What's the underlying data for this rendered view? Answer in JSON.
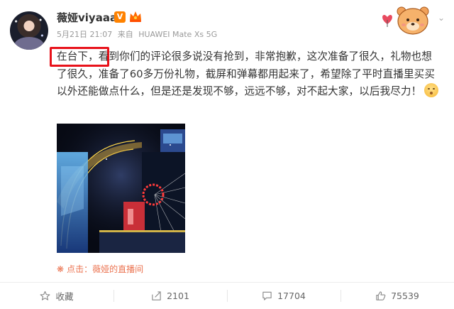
{
  "user": {
    "name": "薇娅viyaaa",
    "verified_badge": "V",
    "avatar_icon": "avatar"
  },
  "meta": {
    "timestamp": "5月21日 21:07",
    "source_prefix": "来自",
    "device": "HUAWEI Mate Xs 5G"
  },
  "post": {
    "text": "在台下，看到你们的评论很多说没有抢到，非常抱歉，这次准备了很久，礼物也想了很久，准备了60多万份礼物，截屏和弹幕都用起来了，希望除了平时直播里买买以外还能做点什么，但是还是发现不够，远远不够，对不起大家，以后我尽力！",
    "emoji_icon": "flushed-face-emoji",
    "highlight_color": "#e8121a"
  },
  "media": {
    "image_icon": "stage-photo"
  },
  "source_link": {
    "icon": "spark-icon",
    "label": "点击：薇娅的直播间",
    "color": "#eb7350"
  },
  "actions": {
    "favorite": {
      "label": "收藏",
      "icon": "star-icon"
    },
    "repost": {
      "count": "2101",
      "icon": "repost-icon"
    },
    "comment": {
      "count": "17704",
      "icon": "comment-icon"
    },
    "like": {
      "count": "75539",
      "icon": "thumbs-up-icon"
    }
  },
  "colors": {
    "accent": "#ff8200",
    "link": "#eb7350",
    "text": "#333333",
    "muted": "#999999"
  }
}
